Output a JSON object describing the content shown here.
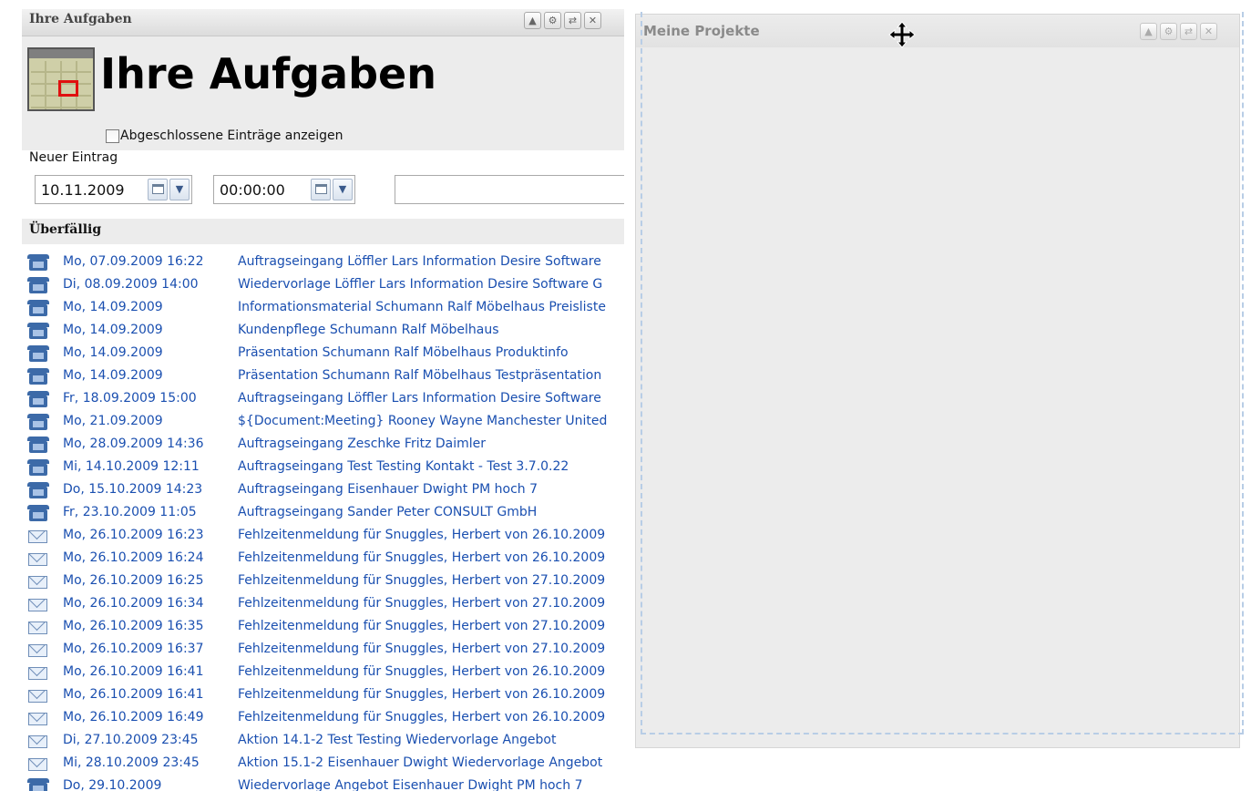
{
  "tasks_panel": {
    "header_title": "Ihre Aufgaben",
    "window_buttons": [
      "▲",
      "⚙",
      "⇄",
      "✕"
    ],
    "hero_title": "Ihre Aufgaben",
    "show_completed_label": "Abgeschlossene Einträge anzeigen",
    "new_entry": {
      "label": "Neuer Eintrag",
      "date_value": "10.11.2009",
      "time_value": "00:00:00",
      "subject_value": ""
    },
    "overdue_section_title": "Überfällig",
    "items": [
      {
        "icon": "phone-icon",
        "date": "Mo, 07.09.2009 16:22",
        "subject": "Auftragseingang Löffler Lars Information Desire Software"
      },
      {
        "icon": "phone-icon",
        "date": "Di, 08.09.2009 14:00",
        "subject": "Wiedervorlage Löffler Lars Information Desire Software G"
      },
      {
        "icon": "phone-icon",
        "date": "Mo, 14.09.2009",
        "subject": "Informationsmaterial Schumann Ralf Möbelhaus Preisliste"
      },
      {
        "icon": "phone-icon",
        "date": "Mo, 14.09.2009",
        "subject": "Kundenpflege Schumann Ralf Möbelhaus"
      },
      {
        "icon": "phone-icon",
        "date": "Mo, 14.09.2009",
        "subject": "Präsentation Schumann Ralf Möbelhaus Produktinfo"
      },
      {
        "icon": "phone-icon",
        "date": "Mo, 14.09.2009",
        "subject": "Präsentation Schumann Ralf Möbelhaus Testpräsentation"
      },
      {
        "icon": "phone-icon",
        "date": "Fr, 18.09.2009 15:00",
        "subject": "Auftragseingang Löffler Lars Information Desire Software"
      },
      {
        "icon": "phone-icon",
        "date": "Mo, 21.09.2009",
        "subject": "${Document:Meeting} Rooney Wayne Manchester United"
      },
      {
        "icon": "phone-icon",
        "date": "Mo, 28.09.2009 14:36",
        "subject": "Auftragseingang Zeschke Fritz Daimler"
      },
      {
        "icon": "phone-icon",
        "date": "Mi, 14.10.2009 12:11",
        "subject": "Auftragseingang Test Testing Kontakt - Test 3.7.0.22"
      },
      {
        "icon": "phone-icon",
        "date": "Do, 15.10.2009 14:23",
        "subject": "Auftragseingang Eisenhauer Dwight PM hoch 7"
      },
      {
        "icon": "phone-icon",
        "date": "Fr, 23.10.2009 11:05",
        "subject": "Auftragseingang Sander Peter CONSULT GmbH"
      },
      {
        "icon": "mail-icon",
        "date": "Mo, 26.10.2009 16:23",
        "subject": "Fehlzeitenmeldung für Snuggles, Herbert von 26.10.2009"
      },
      {
        "icon": "mail-icon",
        "date": "Mo, 26.10.2009 16:24",
        "subject": "Fehlzeitenmeldung für Snuggles, Herbert von 26.10.2009"
      },
      {
        "icon": "mail-icon",
        "date": "Mo, 26.10.2009 16:25",
        "subject": "Fehlzeitenmeldung für Snuggles, Herbert von 27.10.2009"
      },
      {
        "icon": "mail-icon",
        "date": "Mo, 26.10.2009 16:34",
        "subject": "Fehlzeitenmeldung für Snuggles, Herbert von 27.10.2009"
      },
      {
        "icon": "mail-icon",
        "date": "Mo, 26.10.2009 16:35",
        "subject": "Fehlzeitenmeldung für Snuggles, Herbert von 27.10.2009"
      },
      {
        "icon": "mail-icon",
        "date": "Mo, 26.10.2009 16:37",
        "subject": "Fehlzeitenmeldung für Snuggles, Herbert von 27.10.2009"
      },
      {
        "icon": "mail-icon",
        "date": "Mo, 26.10.2009 16:41",
        "subject": "Fehlzeitenmeldung für Snuggles, Herbert von 26.10.2009"
      },
      {
        "icon": "mail-icon",
        "date": "Mo, 26.10.2009 16:41",
        "subject": "Fehlzeitenmeldung für Snuggles, Herbert von 26.10.2009"
      },
      {
        "icon": "mail-icon",
        "date": "Mo, 26.10.2009 16:49",
        "subject": "Fehlzeitenmeldung für Snuggles, Herbert von 26.10.2009"
      },
      {
        "icon": "mail-icon",
        "date": "Di, 27.10.2009 23:45",
        "subject": "Aktion 14.1-2 Test Testing Wiedervorlage Angebot"
      },
      {
        "icon": "mail-icon",
        "date": "Mi, 28.10.2009 23:45",
        "subject": "Aktion 15.1-2 Eisenhauer Dwight Wiedervorlage Angebot"
      },
      {
        "icon": "phone-icon",
        "date": "Do, 29.10.2009",
        "subject": "Wiedervorlage Angebot Eisenhauer Dwight PM hoch 7"
      }
    ]
  },
  "projects_panel": {
    "header_title": "Meine Projekte",
    "window_buttons": [
      "▲",
      "⚙",
      "⇄",
      "✕"
    ]
  },
  "colors": {
    "link_blue": "#1a4fb0",
    "drop_outline": "#b8cde6",
    "panel_gray": "#ececec"
  },
  "cursor": "move-cursor-icon"
}
